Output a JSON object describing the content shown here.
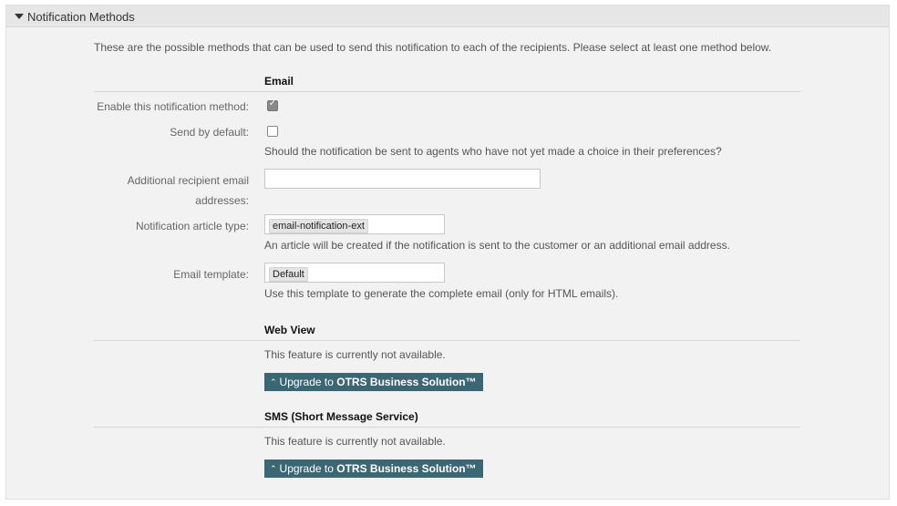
{
  "panel": {
    "title": "Notification Methods",
    "intro": "These are the possible methods that can be used to send this notification to each of the recipients. Please select at least one method below."
  },
  "email": {
    "section_title": "Email",
    "enable_label": "Enable this notification method:",
    "enable_checked": true,
    "send_default_label": "Send by default:",
    "send_default_checked": false,
    "send_default_desc": "Should the notification be sent to agents who have not yet made a choice in their preferences?",
    "recipients_label_line1": "Additional recipient email",
    "recipients_label_line2": "addresses:",
    "recipients_value": "",
    "article_type_label": "Notification article type:",
    "article_type_value": "email-notification-ext",
    "article_type_desc": "An article will be created if the notification is sent to the customer or an additional email address.",
    "template_label": "Email template:",
    "template_value": "Default",
    "template_desc": "Use this template to generate the complete email (only for HTML emails)."
  },
  "webview": {
    "section_title": "Web View",
    "unavailable": "This feature is currently not available.",
    "button_prefix": "Upgrade to ",
    "button_bold": "OTRS Business Solution™"
  },
  "sms": {
    "section_title": "SMS (Short Message Service)",
    "unavailable": "This feature is currently not available.",
    "button_prefix": "Upgrade to ",
    "button_bold": "OTRS Business Solution™"
  },
  "icons": {
    "toggle": "triangle-down-icon",
    "checkmark": "checkmark-icon",
    "upgrade": "double-chevron-up-icon"
  },
  "colors": {
    "panel_bg": "#f2f2f2",
    "header_bg": "#e6e6e6",
    "button_bg": "#3b6674"
  }
}
